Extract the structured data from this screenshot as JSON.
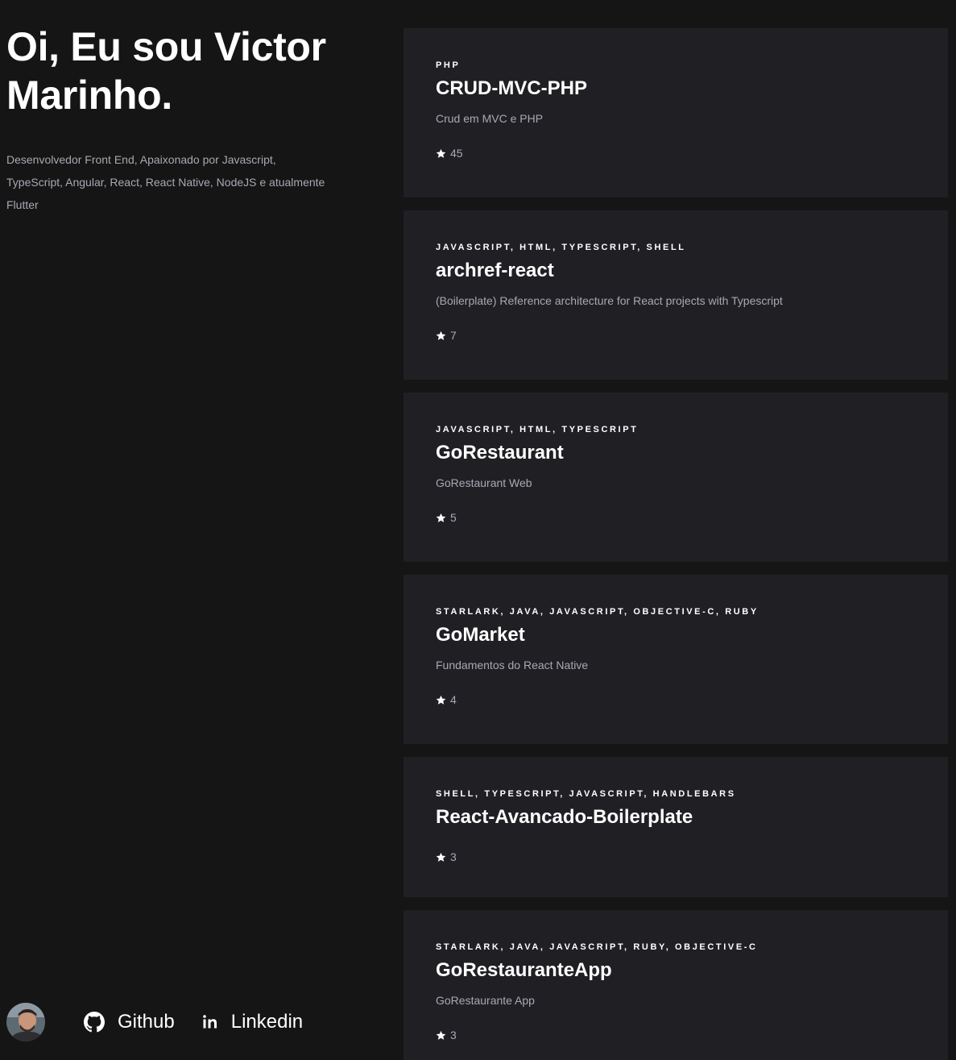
{
  "intro": {
    "title": "Oi, Eu sou Victor Marinho.",
    "bio": "Desenvolvedor Front End, Apaixonado por Javascript, TypeScript, Angular, React, React Native, NodeJS e atualmente Flutter"
  },
  "footer": {
    "avatar_icon": "user-avatar",
    "github_label": "Github",
    "github_icon": "github-icon",
    "linkedin_label": "Linkedin",
    "linkedin_icon": "linkedin-icon"
  },
  "colors": {
    "background": "#151515",
    "card": "#202024",
    "muted_text": "#a8a8b3",
    "text": "#ffffff"
  },
  "projects": [
    {
      "languages": "PHP",
      "name": "CRUD-MVC-PHP",
      "description": "Crud em MVC e PHP",
      "stars": "45"
    },
    {
      "languages": "JAVASCRIPT, HTML, TYPESCRIPT, SHELL",
      "name": "archref-react",
      "description": "(Boilerplate) Reference architecture for React projects with Typescript",
      "stars": "7"
    },
    {
      "languages": "JAVASCRIPT, HTML, TYPESCRIPT",
      "name": "GoRestaurant",
      "description": "GoRestaurant Web",
      "stars": "5"
    },
    {
      "languages": "STARLARK, JAVA, JAVASCRIPT, OBJECTIVE-C, RUBY",
      "name": "GoMarket",
      "description": "Fundamentos do React Native",
      "stars": "4"
    },
    {
      "languages": "SHELL, TYPESCRIPT, JAVASCRIPT, HANDLEBARS",
      "name": "React-Avancado-Boilerplate",
      "description": "",
      "stars": "3"
    },
    {
      "languages": "STARLARK, JAVA, JAVASCRIPT, RUBY, OBJECTIVE-C",
      "name": "GoRestauranteApp",
      "description": "GoRestaurante App",
      "stars": "3"
    }
  ]
}
